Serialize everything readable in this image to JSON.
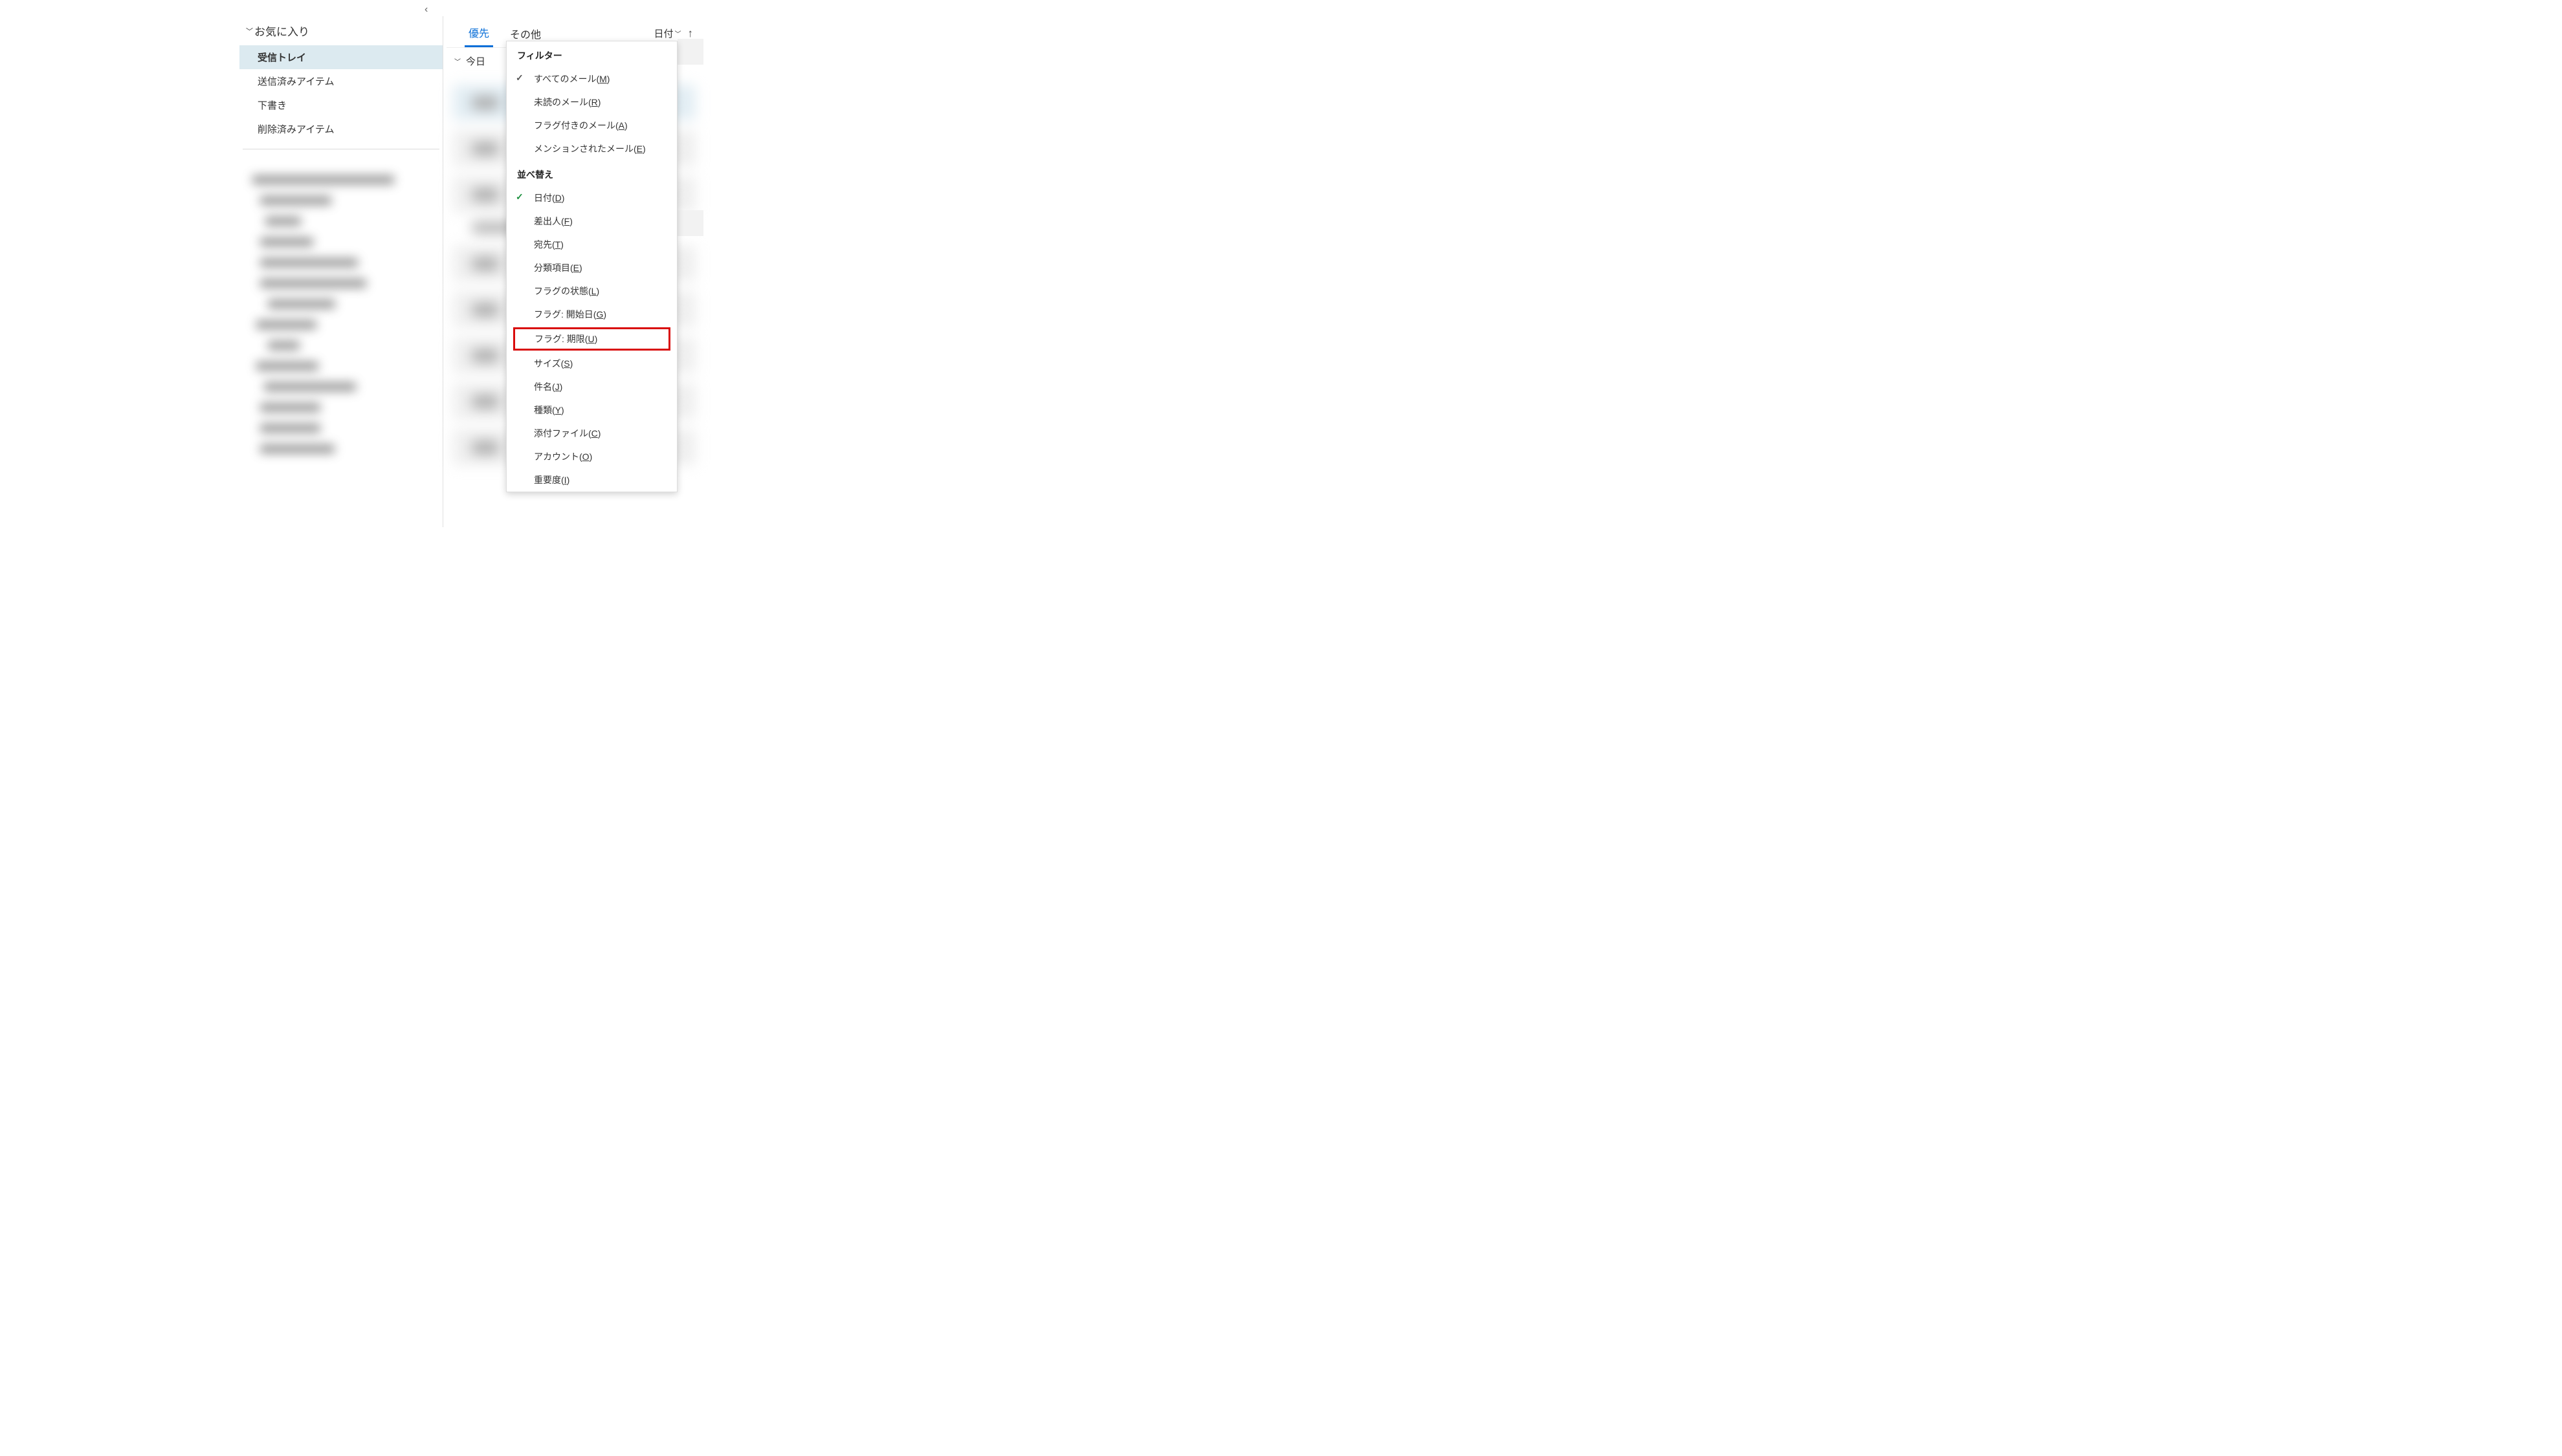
{
  "sidebar": {
    "header": "お気に入り",
    "folders": [
      {
        "label": "受信トレイ",
        "active": true
      },
      {
        "label": "送信済みアイテム",
        "active": false
      },
      {
        "label": "下書き",
        "active": false
      },
      {
        "label": "削除済みアイテム",
        "active": false
      }
    ]
  },
  "tabs": {
    "focused": "優先",
    "other": "その他",
    "sort_label": "日付",
    "group_today": "今日"
  },
  "dropdown": {
    "filter_header": "フィルター",
    "filter_items": [
      {
        "label": "すべてのメール(",
        "accel": "M",
        "suffix": ")",
        "checked": true,
        "checkcolor": "gray"
      },
      {
        "label": "未読のメール(",
        "accel": "R",
        "suffix": ")",
        "checked": false
      },
      {
        "label": "フラグ付きのメール(",
        "accel": "A",
        "suffix": ")",
        "checked": false
      },
      {
        "label": "メンションされたメール(",
        "accel": "E",
        "suffix": ")",
        "checked": false
      }
    ],
    "sort_header": "並べ替え",
    "sort_items": [
      {
        "label": "日付(",
        "accel": "D",
        "suffix": ")",
        "checked": true,
        "highlight": false
      },
      {
        "label": "差出人(",
        "accel": "F",
        "suffix": ")",
        "checked": false,
        "highlight": false
      },
      {
        "label": "宛先(",
        "accel": "T",
        "suffix": ")",
        "checked": false,
        "highlight": false
      },
      {
        "label": "分類項目(",
        "accel": "E",
        "suffix": ")",
        "checked": false,
        "highlight": false
      },
      {
        "label": "フラグの状態(",
        "accel": "L",
        "suffix": ")",
        "checked": false,
        "highlight": false
      },
      {
        "label": "フラグ: 開始日(",
        "accel": "G",
        "suffix": ")",
        "checked": false,
        "highlight": false
      },
      {
        "label": "フラグ: 期限(",
        "accel": "U",
        "suffix": ")",
        "checked": false,
        "highlight": true
      },
      {
        "label": "サイズ(",
        "accel": "S",
        "suffix": ")",
        "checked": false,
        "highlight": false
      },
      {
        "label": "件名(",
        "accel": "J",
        "suffix": ")",
        "checked": false,
        "highlight": false
      },
      {
        "label": "種類(",
        "accel": "Y",
        "suffix": ")",
        "checked": false,
        "highlight": false
      },
      {
        "label": "添付ファイル(",
        "accel": "C",
        "suffix": ")",
        "checked": false,
        "highlight": false
      },
      {
        "label": "アカウント(",
        "accel": "O",
        "suffix": ")",
        "checked": false,
        "highlight": false
      },
      {
        "label": "重要度(",
        "accel": "I",
        "suffix": ")",
        "checked": false,
        "highlight": false
      }
    ]
  }
}
